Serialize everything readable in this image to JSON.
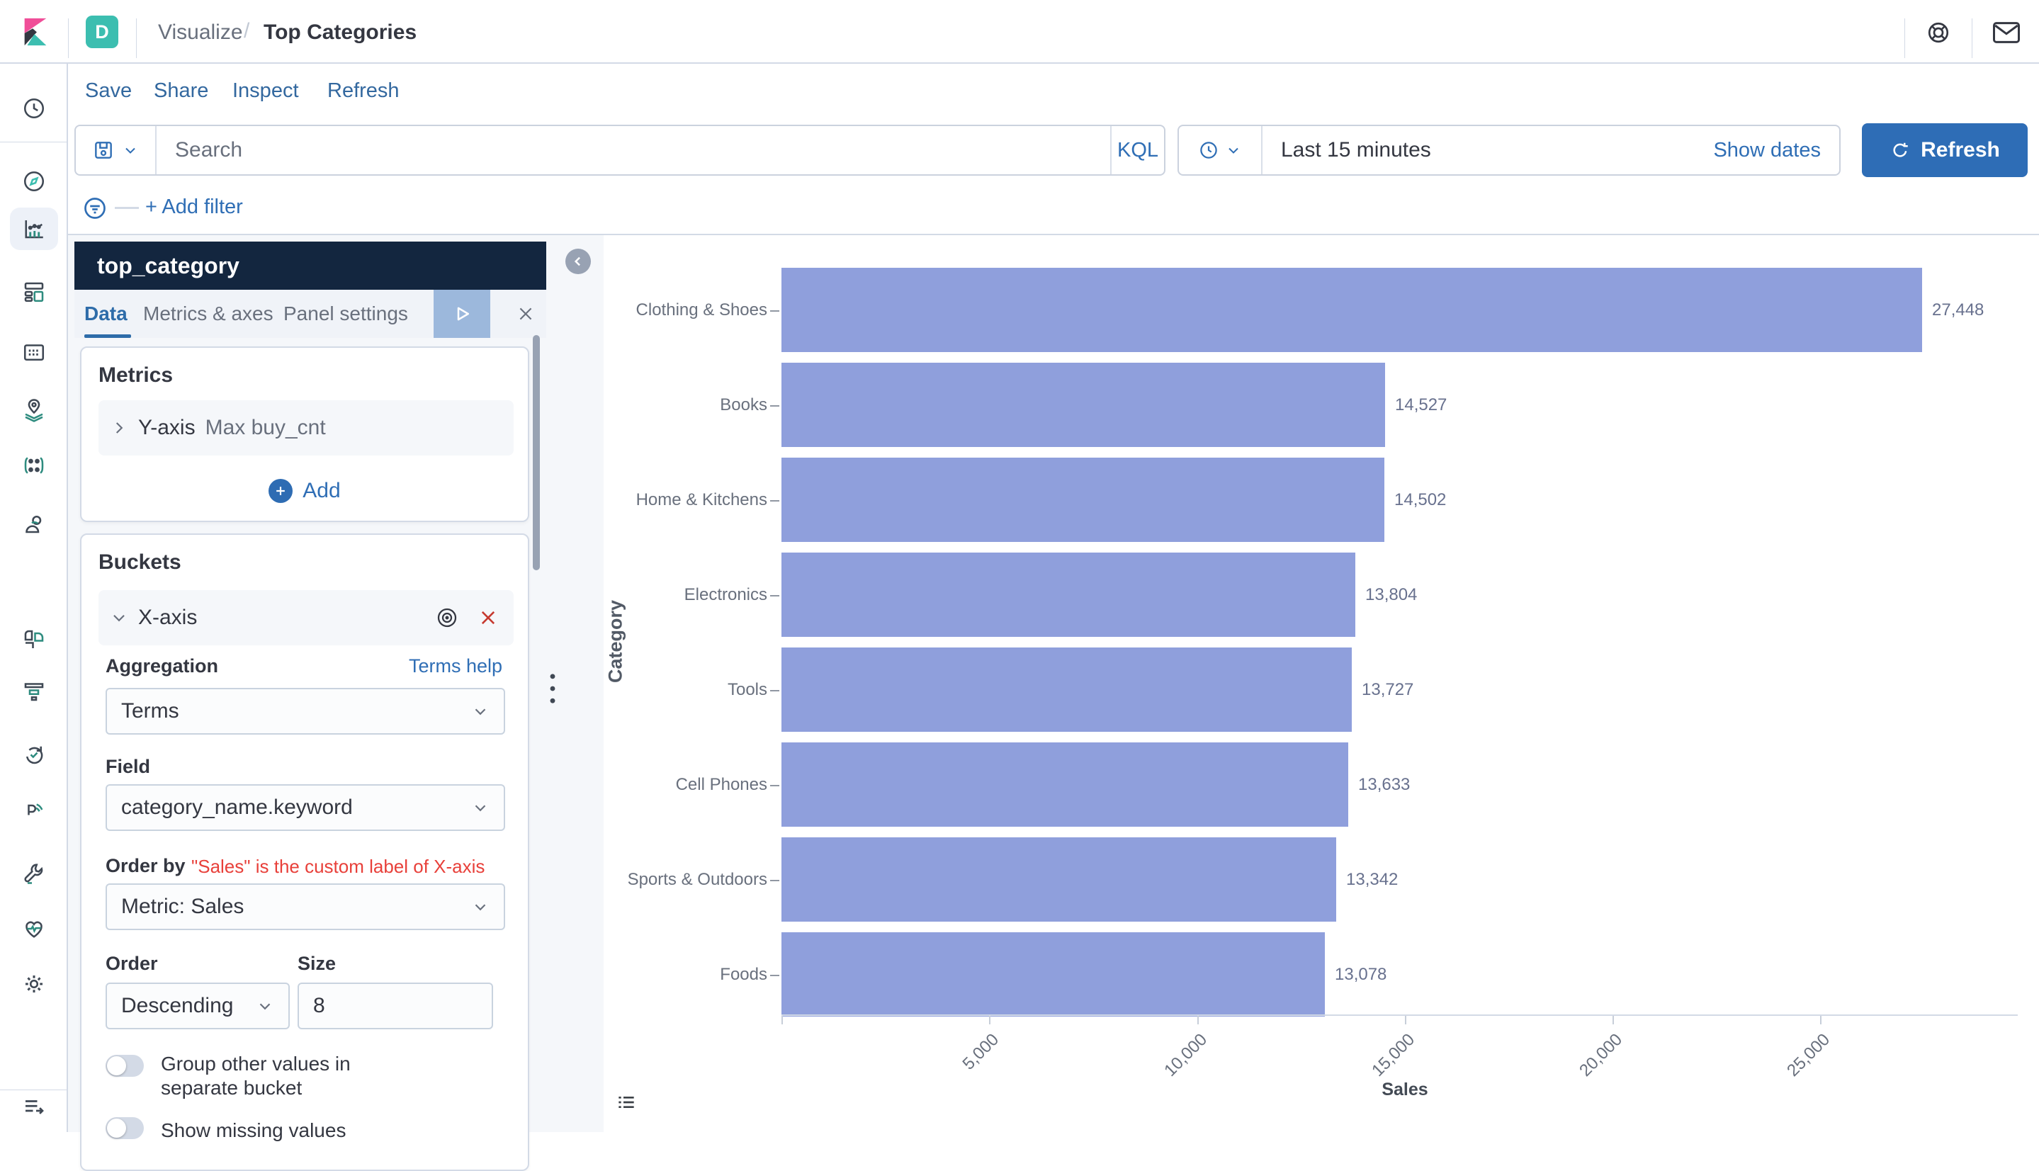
{
  "header": {
    "space_badge": "D",
    "breadcrumb_section": "Visualize",
    "breadcrumb_separator": "/",
    "breadcrumb_current": "Top Categories"
  },
  "toolbar": {
    "items": [
      "Save",
      "Share",
      "Inspect",
      "Refresh"
    ]
  },
  "query": {
    "search_placeholder": "Search",
    "kql": "KQL",
    "time_range": "Last 15 minutes",
    "show_dates": "Show dates",
    "refresh": "Refresh"
  },
  "filters": {
    "add": "+ Add filter"
  },
  "sidebar_icons": [
    "recently-viewed",
    "discover",
    "visualize",
    "dashboard",
    "canvas",
    "maps",
    "machine-learning",
    "graph",
    "logs",
    "metrics",
    "uptime",
    "apm",
    "dev-tools",
    "stack-monitoring",
    "management"
  ],
  "panel": {
    "title": "top_category",
    "tabs": [
      "Data",
      "Metrics & axes",
      "Panel settings"
    ],
    "active_tab": "Data",
    "metrics": {
      "heading": "Metrics",
      "row_label": "Y-axis",
      "row_value": "Max buy_cnt",
      "add_label": "Add"
    },
    "buckets": {
      "heading": "Buckets",
      "axis_row_label": "X-axis",
      "aggregation_label": "Aggregation",
      "terms_help_label": "Terms help",
      "aggregation_value": "Terms",
      "field_label": "Field",
      "field_value": "category_name.keyword",
      "order_by_label": "Order by",
      "order_by_value": "Metric: Sales",
      "annotation": "\"Sales\" is the custom label of X-axis",
      "order_label": "Order",
      "order_value": "Descending",
      "size_label": "Size",
      "size_value": "8",
      "toggle_group_other": "Group other values in separate bucket",
      "toggle_show_missing": "Show missing values"
    }
  },
  "chart_data": {
    "type": "bar",
    "orientation": "horizontal",
    "categories": [
      "Clothing & Shoes",
      "Books",
      "Home & Kitchens",
      "Electronics",
      "Tools",
      "Cell Phones",
      "Sports & Outdoors",
      "Foods"
    ],
    "values": [
      27448,
      14527,
      14502,
      13804,
      13727,
      13633,
      13342,
      13078
    ],
    "value_labels": [
      "27,448",
      "14,527",
      "14,502",
      "13,804",
      "13,727",
      "13,633",
      "13,342",
      "13,078"
    ],
    "xlabel": "Sales",
    "ylabel": "Category",
    "xticks": [
      5000,
      10000,
      15000,
      20000,
      25000
    ],
    "xtick_labels": [
      "5,000",
      "10,000",
      "15,000",
      "20,000",
      "25,000"
    ],
    "xlim": [
      0,
      27448
    ],
    "bar_color": "#8f9fdc",
    "grid": false,
    "legend": "none"
  },
  "colors": {
    "accent_blue": "#2f6eb5",
    "button_blue": "#2e6db6",
    "navy_header": "#13263f",
    "teal_badge": "#3cbeb0",
    "bar_fill": "#8f9fdc",
    "danger_red": "#c6392f",
    "annotation_red": "#e8403a",
    "border": "#d3dae6",
    "text_dark": "#343741",
    "text_gray": "#69707d"
  }
}
